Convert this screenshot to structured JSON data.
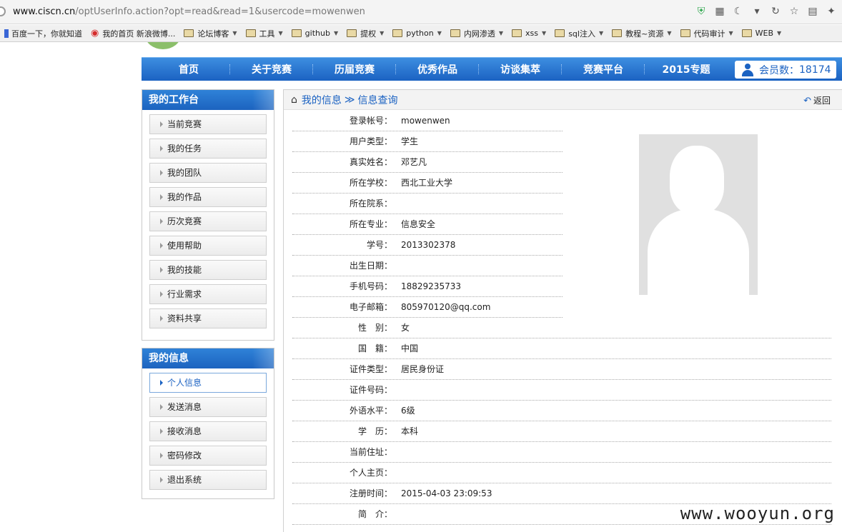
{
  "browser": {
    "url_host": "www.ciscn.cn",
    "url_path": "/optUserInfo.action?opt=read&read=1&usercode=mowenwen"
  },
  "bookmarks": [
    {
      "label": "百度一下，你就知道",
      "type": "site",
      "icon": "baidu-icon"
    },
    {
      "label": "我的首页 新浪微博...",
      "type": "site",
      "icon": "weibo-icon"
    },
    {
      "label": "论坛博客",
      "type": "folder"
    },
    {
      "label": "工具",
      "type": "folder"
    },
    {
      "label": "github",
      "type": "folder"
    },
    {
      "label": "提权",
      "type": "folder"
    },
    {
      "label": "python",
      "type": "folder"
    },
    {
      "label": "内网渗透",
      "type": "folder"
    },
    {
      "label": "xss",
      "type": "folder"
    },
    {
      "label": "sql注入",
      "type": "folder"
    },
    {
      "label": "教程~资源",
      "type": "folder"
    },
    {
      "label": "代码审计",
      "type": "folder"
    },
    {
      "label": "WEB",
      "type": "folder"
    }
  ],
  "nav": {
    "items": [
      "首页",
      "关于竞赛",
      "历届竞赛",
      "优秀作品",
      "访谈集萃",
      "竞赛平台",
      "2015专题"
    ],
    "member_label": "会员数：",
    "member_count": "18174"
  },
  "workbench": {
    "title": "我的工作台",
    "items": [
      "当前竞赛",
      "我的任务",
      "我的团队",
      "我的作品",
      "历次竞赛",
      "使用帮助",
      "我的技能",
      "行业需求",
      "资料共享"
    ]
  },
  "myinfo": {
    "title": "我的信息",
    "items": [
      "个人信息",
      "发送消息",
      "接收消息",
      "密码修改",
      "退出系统"
    ],
    "active_index": 0
  },
  "main": {
    "breadcrumb_1": "我的信息",
    "breadcrumb_sep": "≫",
    "breadcrumb_2": "信息查询",
    "back_label": "返回",
    "fields": [
      {
        "k": "登录帐号：",
        "v": "mowenwen"
      },
      {
        "k": "用户类型：",
        "v": "学生"
      },
      {
        "k": "真实姓名：",
        "v": "邓艺凡"
      },
      {
        "k": "所在学校：",
        "v": "西北工业大学"
      },
      {
        "k": "所在院系：",
        "v": ""
      },
      {
        "k": "所在专业：",
        "v": "信息安全"
      },
      {
        "k": "学号：",
        "v": "2013302378"
      },
      {
        "k": "出生日期：",
        "v": ""
      },
      {
        "k": "手机号码：",
        "v": "18829235733"
      },
      {
        "k": "电子邮箱：",
        "v": "805970120@qq.com"
      },
      {
        "k": "性　别：",
        "v": "女"
      },
      {
        "k": "国　籍：",
        "v": "中国"
      },
      {
        "k": "证件类型：",
        "v": "居民身份证"
      },
      {
        "k": "证件号码：",
        "v": ""
      },
      {
        "k": "外语水平：",
        "v": "6级"
      },
      {
        "k": "学　历：",
        "v": "本科"
      },
      {
        "k": "当前住址：",
        "v": ""
      },
      {
        "k": "个人主页：",
        "v": ""
      },
      {
        "k": "注册时间：",
        "v": "2015-04-03 23:09:53"
      },
      {
        "k": "简　介：",
        "v": ""
      }
    ]
  },
  "watermark": "www.wooyun.org"
}
